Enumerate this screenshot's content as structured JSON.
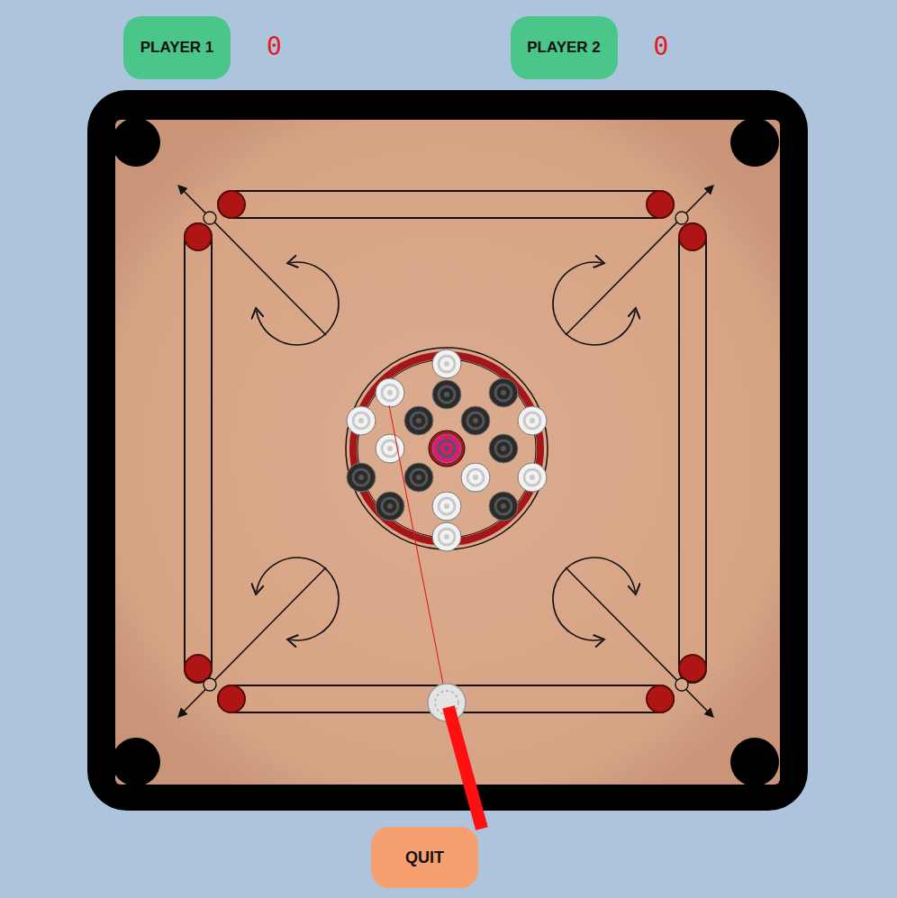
{
  "players": [
    {
      "label": "PLAYER 1",
      "score": "0"
    },
    {
      "label": "PLAYER 2",
      "score": "0"
    }
  ],
  "coins": [
    {
      "color": "#f2f2f2"
    },
    {
      "color": "#f2f2f2"
    },
    {
      "color": "#2b2b2b"
    },
    {
      "color": "#2b2b2b"
    },
    {
      "color": "#f2f2f2"
    },
    {
      "color": "#2b2b2b"
    },
    {
      "color": "#2b2b2b"
    },
    {
      "color": "#f2f2f2"
    },
    {
      "color": "#f2f2f2"
    },
    {
      "color": "#d81b7a"
    },
    {
      "color": "#2b2b2b"
    },
    {
      "color": "#2b2b2b"
    },
    {
      "color": "#2b2b2b"
    },
    {
      "color": "#f2f2f2"
    },
    {
      "color": "#f2f2f2"
    },
    {
      "color": "#2b2b2b"
    },
    {
      "color": "#f2f2f2"
    },
    {
      "color": "#2b2b2b"
    },
    {
      "color": "#f2f2f2"
    }
  ],
  "quit": "QUIT"
}
